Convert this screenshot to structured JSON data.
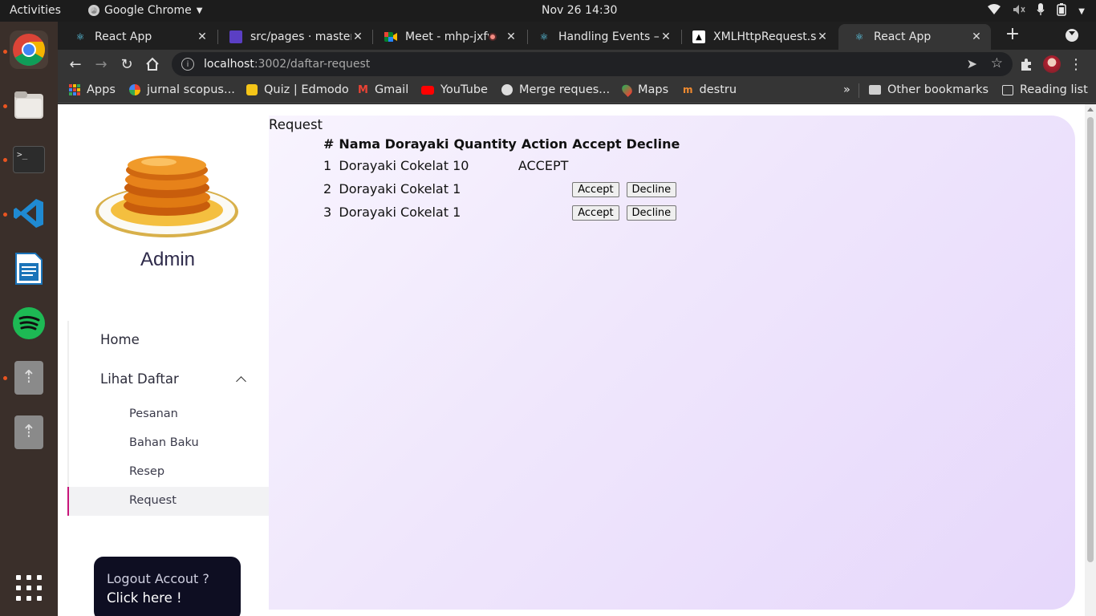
{
  "system": {
    "activities": "Activities",
    "app_menu": "Google Chrome",
    "clock": "Nov 26  14:30"
  },
  "tabs": [
    {
      "title": "React App",
      "active": false
    },
    {
      "title": "src/pages · master",
      "active": false
    },
    {
      "title": "Meet - mhp-jxfv",
      "active": false
    },
    {
      "title": "Handling Events – R",
      "active": false
    },
    {
      "title": "XMLHttpRequest.s",
      "active": false
    },
    {
      "title": "React App",
      "active": true
    }
  ],
  "address": {
    "host": "localhost",
    "path": ":3002/daftar-request"
  },
  "bookmarks": {
    "items": [
      "Apps",
      "jurnal scopus...",
      "Quiz | Edmodo",
      "Gmail",
      "YouTube",
      "Merge reques...",
      "Maps",
      "destru"
    ],
    "overflow": "»",
    "other": "Other bookmarks",
    "reading_list": "Reading list"
  },
  "sidebar": {
    "admin_name": "Admin",
    "nav": {
      "home": "Home",
      "lihat_daftar": "Lihat Daftar",
      "pesanan": "Pesanan",
      "bahan_baku": "Bahan Baku",
      "resep": "Resep",
      "request": "Request"
    },
    "logout": {
      "question": "Logout Accout ?",
      "link": "Click here !"
    }
  },
  "main": {
    "title": "Request",
    "columns": [
      "#",
      "Nama Dorayaki",
      "Quantity",
      "Action",
      "Accept",
      "Decline"
    ],
    "rows": [
      {
        "no": "1",
        "nama": "Dorayaki Cokelat",
        "qty": "10",
        "action": "ACCEPT",
        "accept": "",
        "decline": ""
      },
      {
        "no": "2",
        "nama": "Dorayaki Cokelat",
        "qty": "1",
        "action": "",
        "accept": "Accept",
        "decline": "Decline"
      },
      {
        "no": "3",
        "nama": "Dorayaki Cokelat",
        "qty": "1",
        "action": "",
        "accept": "Accept",
        "decline": "Decline"
      }
    ]
  },
  "colors": {
    "accent": "#c8157a",
    "logout_bg": "#0e0e22",
    "content_gradient_start": "#f8f4fe",
    "content_gradient_end": "#e6d7fb"
  }
}
